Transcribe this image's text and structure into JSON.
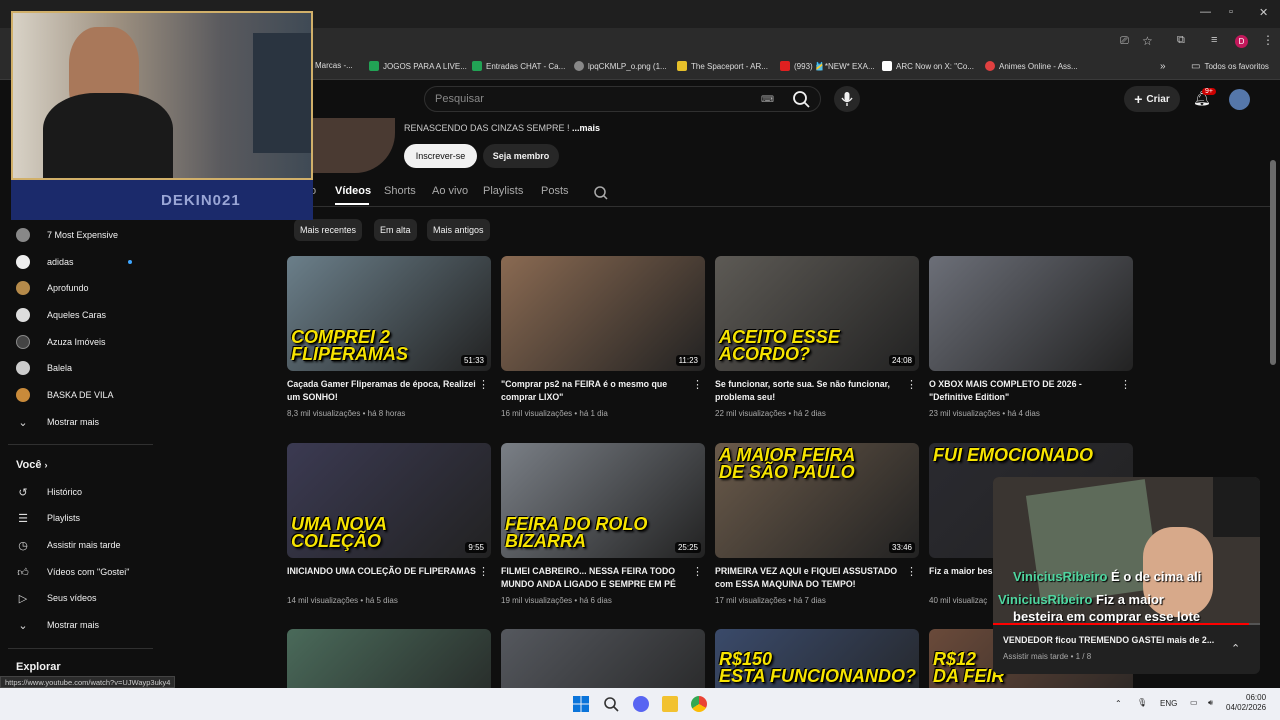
{
  "browser": {
    "bookmarks": [
      {
        "label": "Marcas -...",
        "color": "#ffffff"
      },
      {
        "label": "JOGOS PARA A LIVE...",
        "color": "#22a355"
      },
      {
        "label": "Entradas CHAT - Ca...",
        "color": "#22a355"
      },
      {
        "label": "lpqCKMLP_o.png (1...",
        "color": "#888888"
      },
      {
        "label": "The Spaceport - AR...",
        "color": "#e6c02a"
      },
      {
        "label": "(993) 🎽*NEW* EXA...",
        "color": "#e02020"
      },
      {
        "label": "ARC Now on X: \"Co...",
        "color": "#ffffff"
      },
      {
        "label": "Animes Online - Ass...",
        "color": "#e04040"
      }
    ],
    "favorites_label": "Todos os favoritos",
    "profile_initial": "D",
    "status_url": "https://www.youtube.com/watch?v=UJWayp3uky4"
  },
  "header": {
    "search_placeholder": "Pesquisar",
    "create_label": "Criar",
    "notif_badge": "9+"
  },
  "channel": {
    "desc_text": "RENASCENDO DAS CINZAS SEMPRE !",
    "more_label": "...mais",
    "subscribe_label": "Inscrever-se",
    "member_label": "Seja membro",
    "tabs": [
      "o",
      "Vídeos",
      "Shorts",
      "Ao vivo",
      "Playlists",
      "Posts"
    ],
    "chips": [
      "Mais recentes",
      "Em alta",
      "Mais antigos"
    ]
  },
  "sidebar": {
    "subs": [
      {
        "label": "7 Most Expensive",
        "color": "#888"
      },
      {
        "label": "adidas",
        "color": "#eee"
      },
      {
        "label": "Aprofundo",
        "color": "#b58a4a"
      },
      {
        "label": "Aqueles Caras",
        "color": "#ddd"
      },
      {
        "label": "Azuza Imóveis",
        "color": "#444"
      },
      {
        "label": "Balela",
        "color": "#ccc"
      },
      {
        "label": "BASKA DE VILA",
        "color": "#c88a3a"
      }
    ],
    "show_more": "Mostrar mais",
    "you_label": "Você",
    "you_items": [
      "Histórico",
      "Playlists",
      "Assistir mais tarde",
      "Vídeos com \"Gostei\"",
      "Seus vídeos"
    ],
    "show_more2": "Mostrar mais",
    "explore_label": "Explorar"
  },
  "videos": [
    {
      "title": "Caçada Gamer Fliperamas de época, Realizei um SONHO!",
      "views": "8,3 mil visualizações",
      "age": "há 8 horas",
      "duration": "51:33",
      "caption": "COMPREI 2\nFLIPERAMAS",
      "bg": "#6b7f8a"
    },
    {
      "title": "\"Comprar ps2 na FEIRA é o mesmo que comprar LIXO\"",
      "views": "16 mil visualizações",
      "age": "há 1 dia",
      "duration": "11:23",
      "caption": "",
      "bg": "#8a6a52"
    },
    {
      "title": "Se funcionar, sorte sua. Se não funcionar, problema seu!",
      "views": "22 mil visualizações",
      "age": "há 2 dias",
      "duration": "24:08",
      "caption": "ACEITO ESSE\nACORDO?",
      "bg": "#5d5a55"
    },
    {
      "title": "O XBOX MAIS COMPLETO DE 2026 - \"Definitive Edition\"",
      "views": "23 mil visualizações",
      "age": "há 4 dias",
      "duration": "",
      "caption": "",
      "bg": "#6c6f78"
    },
    {
      "title": "INICIANDO UMA COLEÇÃO DE FLIPERAMAS",
      "views": "14 mil visualizações",
      "age": "há 5 dias",
      "duration": "9:55",
      "caption": "UMA NOVA\nCOLEÇÃO",
      "bg": "#3b3a52"
    },
    {
      "title": "FILMEI CABREIRO... NESSA FEIRA TODO MUNDO ANDA LIGADO E SEMPRE EM PÉ",
      "views": "19 mil visualizações",
      "age": "há 6 dias",
      "duration": "25:25",
      "caption": "FEIRA DO ROLO\nBIZARRA",
      "bg": "#7a7f86"
    },
    {
      "title": "PRIMEIRA VEZ AQUI e FIQUEI ASSUSTADO com ESSA MAQUINA DO TEMPO!",
      "views": "17 mil visualizações",
      "age": "há 7 dias",
      "duration": "33:46",
      "caption": "A MAIOR FEIRA\nDE SÃO PAULO",
      "bg": "#6a5a4a"
    },
    {
      "title": "Fiz a maior bes",
      "views": "40 mil visualizaç",
      "age": "",
      "duration": "",
      "caption": "FUI EMOCIONADO",
      "bg": "#2a2a30"
    },
    {
      "title": "",
      "views": "",
      "age": "",
      "duration": "",
      "caption": "",
      "bg": "#4a6a5a"
    },
    {
      "title": "",
      "views": "",
      "age": "",
      "duration": "",
      "caption": "",
      "bg": "#55585e"
    },
    {
      "title": "",
      "views": "",
      "age": "",
      "duration": "",
      "caption": "R$150\nESTA FUNCIONANDO?",
      "bg": "#3a4a6a"
    },
    {
      "title": "",
      "views": "",
      "age": "",
      "duration": "",
      "caption": "R$12\nDA FEIR",
      "bg": "#6a4a3a"
    }
  ],
  "overlay": {
    "banner_text": "DEKIN021"
  },
  "miniplayer": {
    "chat": [
      {
        "user": "ViniciusRibeiro",
        "msg": "É o de cima ali"
      },
      {
        "user": "ViniciusRibeiro",
        "msg": "Fiz a maior"
      },
      {
        "user": "",
        "msg": "besteira em comprar esse lote"
      }
    ],
    "title": "VENDEDOR ficou TREMENDO GASTEI mais de 2...",
    "queue": "Assistir mais tarde • 1 / 8"
  },
  "taskbar": {
    "lang": "ENG",
    "time": "06:00",
    "date": "04/02/2026"
  }
}
